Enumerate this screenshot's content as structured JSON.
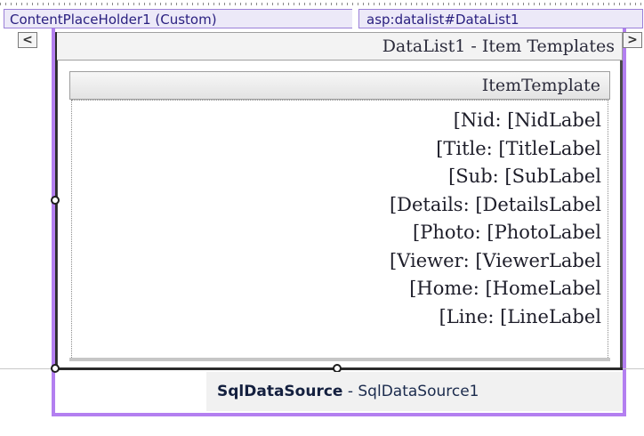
{
  "tabs": {
    "content_placeholder": "ContentPlaceHolder1 (Custom)",
    "datalist": "asp:datalist#DataList1"
  },
  "scroll": {
    "left": "<",
    "right": ">"
  },
  "datalist": {
    "header": "DataList1 - Item Templates",
    "template_header": "ItemTemplate",
    "fields": [
      "[Nid: [NidLabel",
      "[Title: [TitleLabel",
      "[Sub: [SubLabel",
      "[Details: [DetailsLabel",
      "[Photo: [PhotoLabel",
      "[Viewer: [ViewerLabel",
      "[Home: [HomeLabel",
      "[Line: [LineLabel"
    ]
  },
  "sqldatasource": {
    "type": "SqlDataSource",
    "separator": " - ",
    "name": "SqlDataSource1"
  },
  "colors": {
    "accent_purple": "#b37ff0",
    "tab_border": "#9b80d8",
    "tab_text": "#2a2080"
  }
}
